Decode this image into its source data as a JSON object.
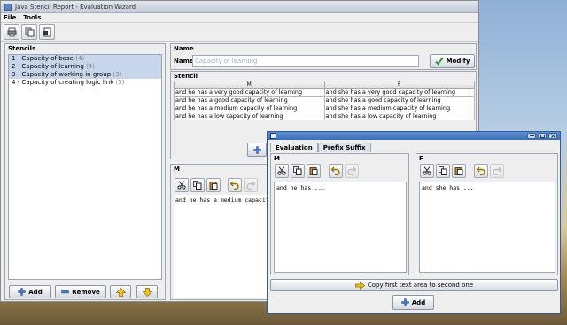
{
  "main_window": {
    "title": "Java Stencil Report - Evaluation Wizard",
    "menu": [
      "File",
      "Tools"
    ],
    "toolbar_icons": [
      "print-icon",
      "copy-pages-icon",
      "export-icon"
    ]
  },
  "stencils": {
    "title": "Stencils",
    "items": [
      {
        "label": "1 - Capacity of base",
        "count": "(4)",
        "selected": true
      },
      {
        "label": "2 - Capacity of learning",
        "count": "(4)",
        "selected": true
      },
      {
        "label": "3 - Capacity of working in group",
        "count": "(3)",
        "selected": true
      },
      {
        "label": "4 - Capacity of creating logic link",
        "count": "(5)",
        "selected": false
      }
    ],
    "buttons": {
      "add": "Add",
      "remove": "Remove"
    }
  },
  "name_panel": {
    "title": "Name",
    "label": "Name:",
    "value": "Capacity of learning",
    "modify_label": "Modify"
  },
  "stencil_panel": {
    "title": "Stencil",
    "columns": [
      "M",
      "F"
    ],
    "rows": [
      [
        "and he has a very good capacity of learning",
        "and she has a very good capacity of learning"
      ],
      [
        "and he has a good capacity of learning",
        "and she has a good capacity of learning"
      ],
      [
        "and he has a medium capacity of learning",
        "and she has a medium capacity of learning"
      ],
      [
        "and he has a low capacity of learning",
        "and she has a low capacity of learning"
      ]
    ]
  },
  "m_panel": {
    "title": "M",
    "text": "and he has a medium capacity"
  },
  "eval_dialog": {
    "tabs": [
      "Evaluation",
      "Prefix Suffix"
    ],
    "active_tab": "Evaluation",
    "left": {
      "title": "M",
      "text": "and he has ..."
    },
    "right": {
      "title": "F",
      "text": "and she has ..."
    },
    "copy_label": "Copy first text area to second one",
    "add_label": "Add"
  },
  "colors": {
    "selection": "#c8d6ec",
    "check_green": "#2e9b2e",
    "dialog_title": "#3e6fb6"
  }
}
